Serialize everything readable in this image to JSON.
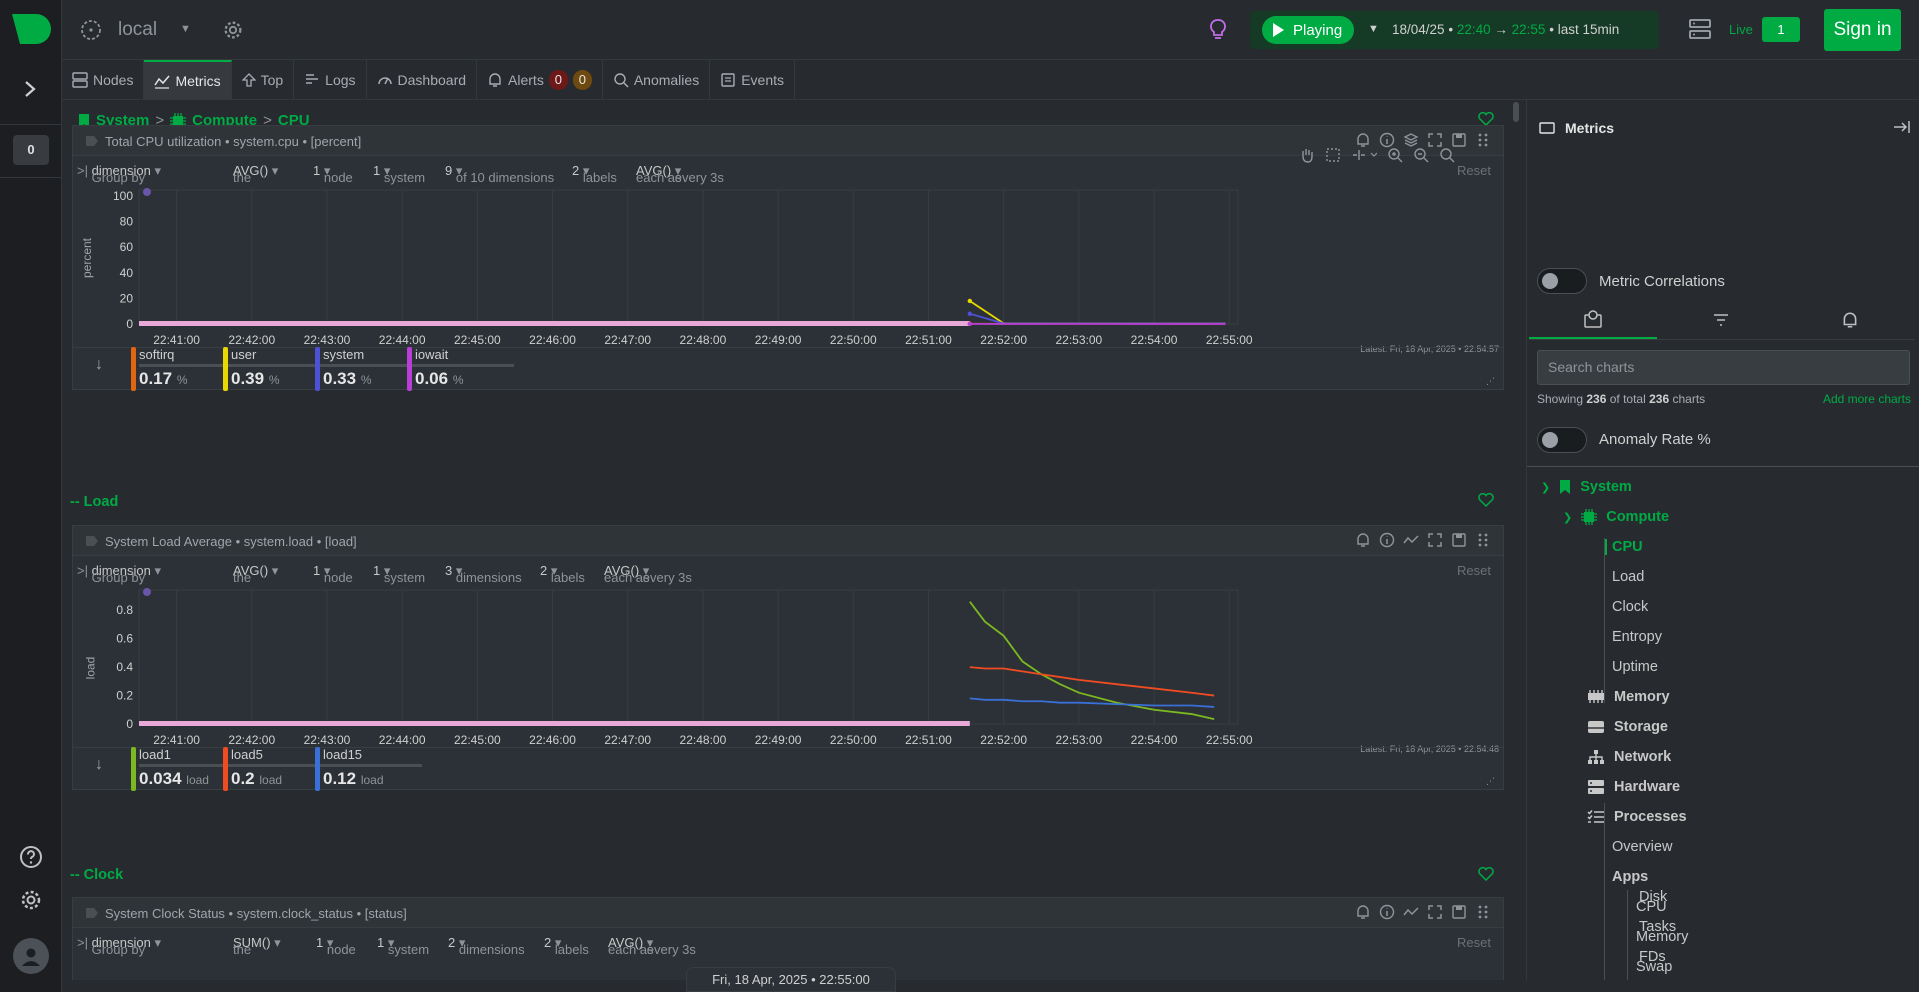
{
  "rail": {
    "space_badge": "0"
  },
  "topbar": {
    "room_name": "local",
    "play_label": "Playing",
    "date": "18/04/25",
    "bullet": "•",
    "time_from": "22:40",
    "arrow": "→",
    "time_to": "22:55",
    "range_text": "last  15min",
    "live_label": "Live",
    "live_count": "1",
    "signin_label": "Sign in"
  },
  "tabs": [
    {
      "label": "Nodes"
    },
    {
      "label": "Metrics"
    },
    {
      "label": "Top"
    },
    {
      "label": "Logs"
    },
    {
      "label": "Dashboard"
    },
    {
      "label": "Alerts",
      "critical": "0",
      "warning": "0"
    },
    {
      "label": "Anomalies"
    },
    {
      "label": "Events"
    }
  ],
  "breadcrumb": [
    "System",
    "Compute",
    "CPU"
  ],
  "breadcrumb_sep": ">",
  "sections": {
    "load": "-- Load",
    "clock": "-- Clock"
  },
  "charts": {
    "cpu": {
      "title": "Total CPU utilization • system.cpu • [percent]",
      "group_by": "Group by",
      "group_by_value": "dimension",
      "agg": "the",
      "agg_value": "AVG()",
      "nodes": "1",
      "nodes_label": "node",
      "systems": "1",
      "systems_label": "system",
      "dims": "9",
      "dims_label": "of 10 dimensions",
      "labels": "2",
      "labels_label": "labels",
      "each": "each as",
      "each_value": "AVG()",
      "every": "every 3s",
      "reset": "Reset",
      "ylabel": "percent",
      "latest": "Latest:  Fri, 18 Apr, 2025 • 22:54:57",
      "legend": [
        {
          "name": "softirq",
          "value": "0.17",
          "unit": "%",
          "color": "#e0670f"
        },
        {
          "name": "user",
          "value": "0.39",
          "unit": "%",
          "color": "#e8d800"
        },
        {
          "name": "system",
          "value": "0.33",
          "unit": "%",
          "color": "#4c51d6"
        },
        {
          "name": "iowait",
          "value": "0.06",
          "unit": "%",
          "color": "#b83fd6"
        }
      ]
    },
    "load": {
      "title": "System Load Average • system.load • [load]",
      "group_by": "Group by",
      "group_by_value": "dimension",
      "agg": "the",
      "agg_value": "AVG()",
      "nodes": "1",
      "nodes_label": "node",
      "systems": "1",
      "systems_label": "system",
      "dims": "3",
      "dims_label": "dimensions",
      "labels": "2",
      "labels_label": "labels",
      "each": "each as",
      "each_value": "AVG()",
      "every": "every 3s",
      "reset": "Reset",
      "ylabel": "load",
      "latest": "Latest:  Fri, 18 Apr, 2025 • 22:54:48",
      "legend": [
        {
          "name": "load1",
          "value": "0.034",
          "unit": "load",
          "color": "#7cb820"
        },
        {
          "name": "load5",
          "value": "0.2",
          "unit": "load",
          "color": "#f04c22"
        },
        {
          "name": "load15",
          "value": "0.12",
          "unit": "load",
          "color": "#3a6fd6"
        }
      ]
    },
    "clock": {
      "title": "System Clock Status • system.clock_status • [status]",
      "group_by": "Group by",
      "group_by_value": "dimension",
      "agg": "the",
      "agg_value": "SUM()",
      "nodes": "1",
      "nodes_label": "node",
      "systems": "1",
      "systems_label": "system",
      "dims": "2",
      "dims_label": "dimensions",
      "labels": "2",
      "labels_label": "labels",
      "each": "each as",
      "each_value": "AVG()",
      "every": "every 3s",
      "reset": "Reset"
    }
  },
  "bottom_timestamp": "Fri, 18 Apr, 2025 • 22:55:00",
  "panel": {
    "title": "Metrics",
    "metric_correlations": "Metric Correlations",
    "search_placeholder": "Search charts",
    "showing_prefix": "Showing",
    "showing_count": "236",
    "showing_mid": "of total",
    "showing_total": "236",
    "showing_suffix": "charts",
    "add_more": "Add more charts",
    "anomaly_rate": "Anomaly Rate %",
    "tree": {
      "system": "System",
      "compute": "Compute",
      "cpu": "CPU",
      "load": "Load",
      "clock": "Clock",
      "entropy": "Entropy",
      "uptime": "Uptime",
      "memory": "Memory",
      "storage": "Storage",
      "network": "Network",
      "hardware": "Hardware",
      "processes": "Processes",
      "overview": "Overview",
      "apps": "Apps",
      "apps_cpu": "CPU",
      "apps_memory": "Memory",
      "apps_swap": "Swap",
      "apps_disk": "Disk",
      "apps_tasks": "Tasks",
      "apps_fds": "FDs"
    }
  },
  "colors": {
    "accent": "#00ab44",
    "background": "#272b30"
  },
  "chart_data": [
    {
      "type": "line",
      "title": "Total CPU utilization",
      "ylabel": "percent",
      "ylim": [
        0,
        100
      ],
      "yticks": [
        0,
        20,
        40,
        60,
        80,
        100
      ],
      "xticks": [
        "22:41:00",
        "22:42:00",
        "22:43:00",
        "22:44:00",
        "22:45:00",
        "22:46:00",
        "22:47:00",
        "22:48:00",
        "22:49:00",
        "22:50:00",
        "22:51:00",
        "22:52:00",
        "22:53:00",
        "22:54:00",
        "22:55:00"
      ],
      "series": [
        {
          "name": "softirq",
          "color": "#e0670f",
          "values": [
            0.2,
            0.17,
            0.18,
            0.17,
            0.16,
            0.17
          ]
        },
        {
          "name": "user",
          "color": "#e8d800",
          "values": [
            18,
            0.5,
            0.4,
            0.39,
            0.41,
            0.39
          ]
        },
        {
          "name": "system",
          "color": "#4c51d6",
          "values": [
            8,
            0.4,
            0.35,
            0.33,
            0.34,
            0.33
          ]
        },
        {
          "name": "iowait",
          "color": "#b83fd6",
          "values": [
            0.1,
            0.06,
            0.07,
            0.06,
            0.05,
            0.06
          ]
        }
      ],
      "x_times": [
        "22:51:33",
        "22:52:00",
        "22:53:00",
        "22:54:00",
        "22:54:30",
        "22:54:57"
      ],
      "grid": true
    },
    {
      "type": "line",
      "title": "System Load Average",
      "ylabel": "load",
      "ylim": [
        0,
        0.9
      ],
      "yticks": [
        0,
        0.2,
        0.4,
        0.6,
        0.8
      ],
      "xticks": [
        "22:41:00",
        "22:42:00",
        "22:43:00",
        "22:44:00",
        "22:45:00",
        "22:46:00",
        "22:47:00",
        "22:48:00",
        "22:49:00",
        "22:50:00",
        "22:51:00",
        "22:52:00",
        "22:53:00",
        "22:54:00",
        "22:55:00"
      ],
      "x_times": [
        "22:51:33",
        "22:51:45",
        "22:52:00",
        "22:52:15",
        "22:52:30",
        "22:52:45",
        "22:53:00",
        "22:53:30",
        "22:54:00",
        "22:54:30",
        "22:54:48"
      ],
      "series": [
        {
          "name": "load1",
          "color": "#7cb820",
          "values": [
            0.86,
            0.72,
            0.62,
            0.44,
            0.35,
            0.28,
            0.22,
            0.15,
            0.1,
            0.07,
            0.034
          ]
        },
        {
          "name": "load5",
          "color": "#f04c22",
          "values": [
            0.4,
            0.39,
            0.39,
            0.37,
            0.35,
            0.33,
            0.31,
            0.28,
            0.25,
            0.22,
            0.2
          ]
        },
        {
          "name": "load15",
          "color": "#3a6fd6",
          "values": [
            0.18,
            0.17,
            0.17,
            0.16,
            0.16,
            0.15,
            0.15,
            0.14,
            0.13,
            0.13,
            0.12
          ]
        }
      ],
      "grid": true
    }
  ]
}
